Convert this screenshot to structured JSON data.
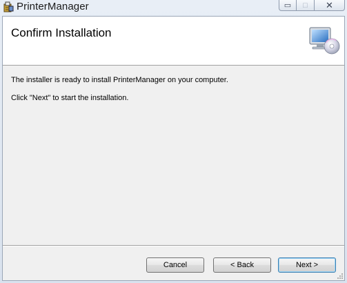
{
  "window": {
    "title": "PrinterManager",
    "controls": {
      "minimize": "▭",
      "maximize": "□",
      "close": "✕"
    }
  },
  "banner": {
    "heading": "Confirm Installation",
    "icon": "computer-disc-icon"
  },
  "body": {
    "line1": "The installer is ready to install PrinterManager on your computer.",
    "line2": "Click \"Next\" to start the installation."
  },
  "buttons": {
    "cancel": "Cancel",
    "back": "< Back",
    "next": "Next >"
  },
  "colors": {
    "title_bar": "#dfe6ee",
    "banner_bg": "#ffffff",
    "client_bg": "#f0f0f0",
    "default_button_border": "#3c7fb1"
  }
}
